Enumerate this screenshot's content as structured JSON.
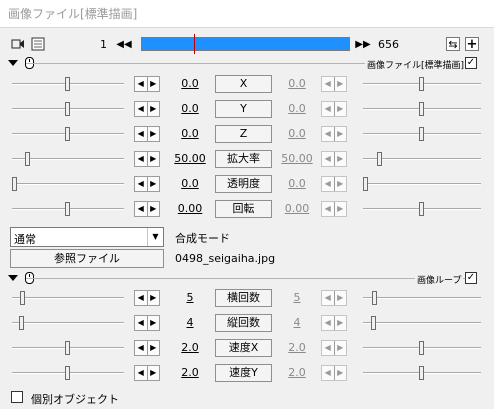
{
  "window": {
    "title": "画像ファイル[標準描画]"
  },
  "toolbar": {
    "frame_start": "1",
    "frame_end": "656",
    "prev_label": "◀◀",
    "next_label": "▶▶",
    "icons": [
      "camera-icon",
      "grid-icon",
      "link-icon",
      "plus-icon"
    ],
    "plus_label": "+",
    "link_label": "⇆"
  },
  "group1": {
    "label": "画像ファイル[標準描画]",
    "checked": true,
    "check_mark": "✓"
  },
  "params": [
    {
      "name": "X",
      "left": "0.0",
      "right": "0.0",
      "left_level": 0.5,
      "right_level": 0.5
    },
    {
      "name": "Y",
      "left": "0.0",
      "right": "0.0",
      "left_level": 0.5,
      "right_level": 0.5
    },
    {
      "name": "Z",
      "left": "0.0",
      "right": "0.0",
      "left_level": 0.5,
      "right_level": 0.5
    },
    {
      "name": "拡大率",
      "left": "50.00",
      "right": "50.00",
      "left_level": 0.125,
      "right_level": 0.125
    },
    {
      "name": "透明度",
      "left": "0.0",
      "right": "0.0",
      "left_level": 0.0,
      "right_level": 0.0
    },
    {
      "name": "回転",
      "left": "0.00",
      "right": "0.00",
      "left_level": 0.5,
      "right_level": 0.5
    }
  ],
  "blend": {
    "value": "通常",
    "label": "合成モード",
    "arrow": "▼"
  },
  "reference": {
    "button_label": "参照ファイル",
    "filename": "0498_seigaiha.jpg"
  },
  "group2": {
    "label": "画像ループ",
    "checked": true,
    "check_mark": "✓"
  },
  "loop_params": [
    {
      "name": "横回数",
      "left": "5",
      "right": "5",
      "left_level": 0.08,
      "right_level": 0.08
    },
    {
      "name": "縦回数",
      "left": "4",
      "right": "4",
      "left_level": 0.07,
      "right_level": 0.07
    },
    {
      "name": "速度X",
      "left": "2.0",
      "right": "2.0",
      "left_level": 0.5,
      "right_level": 0.5
    },
    {
      "name": "速度Y",
      "left": "2.0",
      "right": "2.0",
      "left_level": 0.5,
      "right_level": 0.5
    }
  ],
  "individual_object": {
    "label": "個別オブジェクト",
    "checked": false
  },
  "spin_labels": {
    "dec": "◀",
    "inc": "▶"
  }
}
